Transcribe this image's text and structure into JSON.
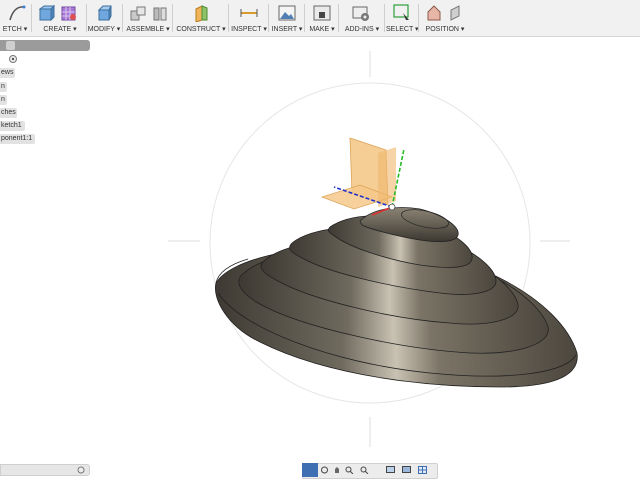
{
  "toolbar": {
    "groups": [
      {
        "label": "ETCH ▾"
      },
      {
        "label": "CREATE ▾"
      },
      {
        "label": "MODIFY ▾"
      },
      {
        "label": "ASSEMBLE ▾"
      },
      {
        "label": "CONSTRUCT ▾"
      },
      {
        "label": "INSPECT ▾"
      },
      {
        "label": "INSERT ▾"
      },
      {
        "label": "MAKE ▾"
      },
      {
        "label": "ADD-INS ▾"
      },
      {
        "label": "SELECT ▾"
      },
      {
        "label": "POSITION ▾"
      }
    ]
  },
  "browser": {
    "nodes": [
      {
        "label": "ews"
      },
      {
        "label": "n"
      },
      {
        "label": "n"
      },
      {
        "label": "ches"
      },
      {
        "label": "ketch1"
      },
      {
        "label": "ponent1:1"
      }
    ]
  },
  "colors": {
    "toolbar_bg": "#f1f1f1",
    "browser_header": "#9b9b9b",
    "plane": "#f5c98a",
    "axis_x": "#e03030",
    "axis_y": "#22bb22",
    "axis_z": "#2233cc",
    "model_dark": "#4e4a41",
    "model_light": "#cfc8b9",
    "navbar_active": "#3e6fb3"
  },
  "icons": [
    "sketch-icon",
    "create-box-icon",
    "create-form-icon",
    "modify-icon",
    "assemble-icon",
    "construct-plane-icon",
    "inspect-measure-icon",
    "insert-image-icon",
    "make-3dprint-icon",
    "add-ins-icon",
    "select-icon",
    "position-icon",
    "view-cube-icon",
    "orbit-icon",
    "pan-icon",
    "zoom-icon",
    "fit-icon",
    "display-icon",
    "grid-icon"
  ]
}
